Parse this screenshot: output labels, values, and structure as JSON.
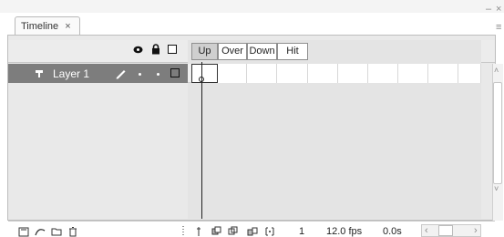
{
  "window": {
    "tab_title": "Timeline",
    "tab_close": "×",
    "minimize": "–",
    "close": "×",
    "menu": "≡"
  },
  "header_icons": [
    "eye-icon",
    "lock-icon",
    "outline-icon"
  ],
  "frame_labels": {
    "up": "Up",
    "over": "Over",
    "down": "Down",
    "hit": "Hit"
  },
  "layers": [
    {
      "name": "Layer 1",
      "icon": "layer-icon",
      "editing_icon": "pencil-icon"
    }
  ],
  "status": {
    "current_frame": "1",
    "frame_rate": "12.0 fps",
    "elapsed_time": "0.0s"
  },
  "scroll": {
    "left_arrow": "‹",
    "right_arrow": "›",
    "up_arrow": "˄",
    "down_arrow": "˅"
  },
  "colors": {
    "layer_row_bg": "#7d7d7d",
    "panel_bg": "#e9e9e9"
  }
}
